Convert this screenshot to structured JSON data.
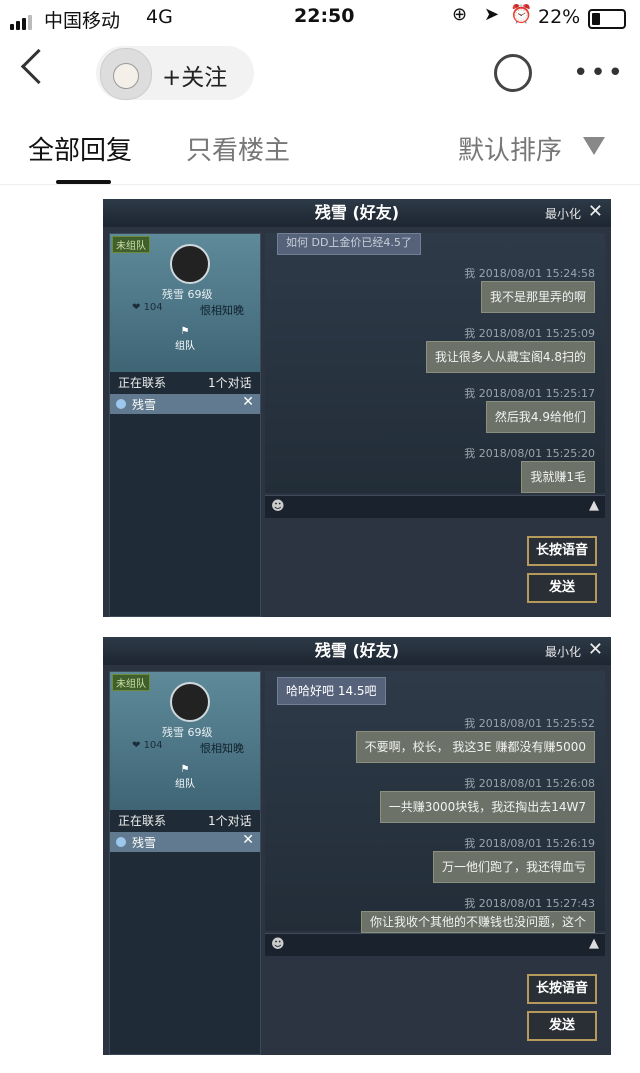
{
  "status_bar": {
    "carrier": "中国移动",
    "network": "4G",
    "time": "22:50",
    "battery": "22%"
  },
  "nav": {
    "follow_label": "+关注"
  },
  "tabs": {
    "all_replies": "全部回复",
    "op_only": "只看楼主",
    "sort": "默认排序"
  },
  "panel_common": {
    "title": "残雪 (好友)",
    "minimize": "最小化",
    "close": "✕",
    "tag": "未组队",
    "name_level": "残雪 69级",
    "heart_value": "104",
    "signature": "恨相知晚",
    "team": "组队",
    "contacting": "正在联系",
    "dialog_count": "1个对话",
    "contact_name": "残雪",
    "voice_button": "长按语音",
    "send_button": "发送"
  },
  "panel1": {
    "partial_top": "如何 DD上金价已经4.5了",
    "messages": [
      {
        "meta": "我 2018/08/01 15:24:58",
        "text": "我不是那里弄的啊"
      },
      {
        "meta": "我 2018/08/01 15:25:09",
        "text": "我让很多人从藏宝阁4.8扫的"
      },
      {
        "meta": "我 2018/08/01 15:25:17",
        "text": "然后我4.9给他们"
      },
      {
        "meta": "我 2018/08/01 15:25:20",
        "text": "我就赚1毛"
      }
    ]
  },
  "panel2": {
    "left_message": "哈哈好吧 14.5吧",
    "messages": [
      {
        "meta": "我 2018/08/01 15:25:52",
        "text": "不要啊，校长， 我这3E 赚都没有赚5000"
      },
      {
        "meta": "我 2018/08/01 15:26:08",
        "text": "一共赚3000块钱，我还掏出去14W7"
      },
      {
        "meta": "我 2018/08/01 15:26:19",
        "text": "万一他们跑了，我还得血亏"
      },
      {
        "meta": "我 2018/08/01 15:27:43",
        "text": "你让我收个其他的不赚钱也没问题，这个"
      }
    ]
  }
}
